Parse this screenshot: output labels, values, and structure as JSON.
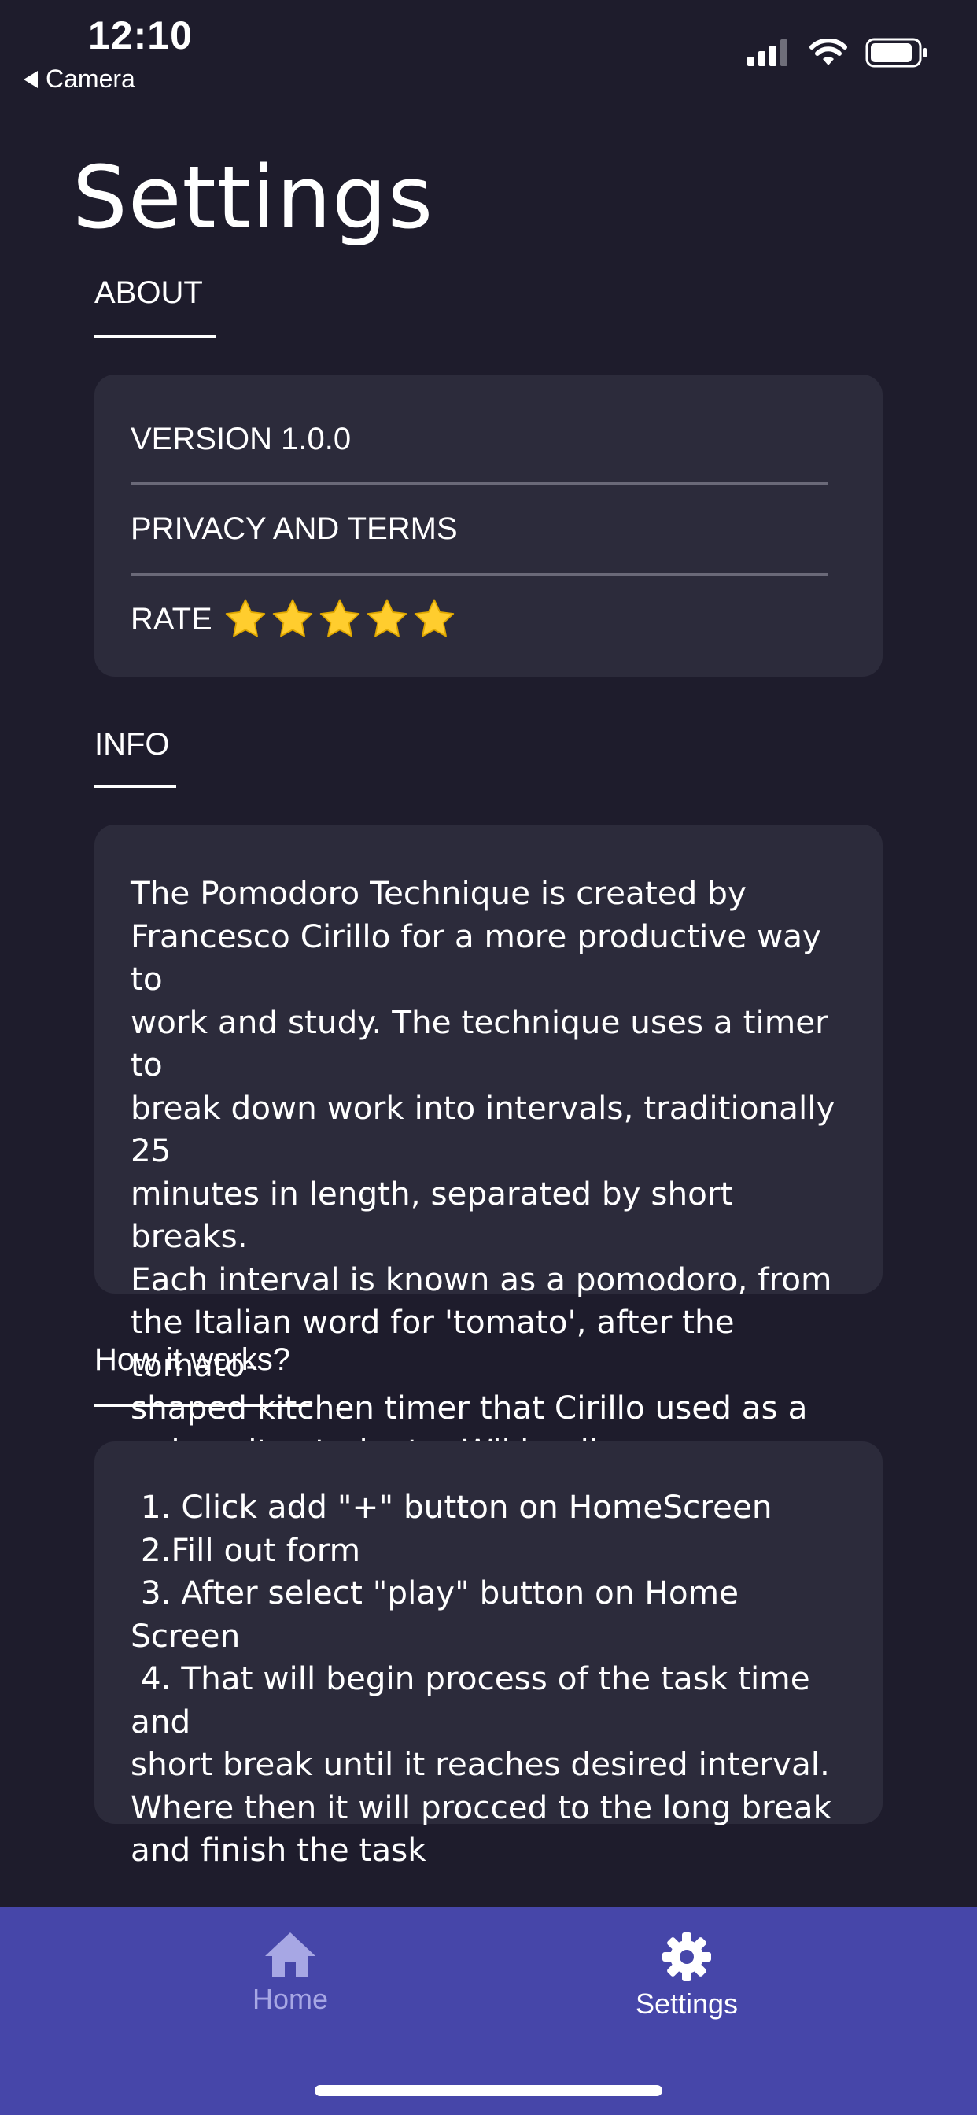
{
  "status_bar": {
    "time": "12:10",
    "back_label": "Camera"
  },
  "page": {
    "title": "Settings"
  },
  "about": {
    "header": "ABOUT",
    "version": "VERSION 1.0.0",
    "privacy": "PRIVACY AND TERMS",
    "rate_label": "RATE",
    "rating": 5,
    "rating_max": 5
  },
  "info": {
    "header": "INFO",
    "text": "The Pomodoro Technique is created by\nFrancesco Cirillo for a more productive way to\nwork and study. The technique uses a timer to\nbreak down work into intervals, traditionally 25\nminutes in length, separated by short breaks.\nEach interval is known as a pomodoro, from\nthe Italian word for 'tomato', after the tomato-\nshaped kitchen timer that Cirillo used as a\nuniversity student. - Wikipedia"
  },
  "how": {
    "header": "How it works?",
    "text": " 1. Click add \"+\" button on HomeScreen\n 2.Fill out form\n 3. After select \"play\" button on Home Screen\n 4. That will begin process of the task time and\nshort break until it reaches desired interval.\nWhere then it will procced to the long break\nand finish the task"
  },
  "tab_bar": {
    "tabs": [
      {
        "label": "Home",
        "icon": "home-icon",
        "active": false
      },
      {
        "label": "Settings",
        "icon": "gear-icon",
        "active": true
      }
    ]
  },
  "colors": {
    "background": "#1e1c2c",
    "card": "#2c2b3b",
    "tab_bar": "#4646a9",
    "tab_inactive": "#a7a7e4",
    "tab_active": "#ffffff",
    "star": "#ffcd2e"
  }
}
